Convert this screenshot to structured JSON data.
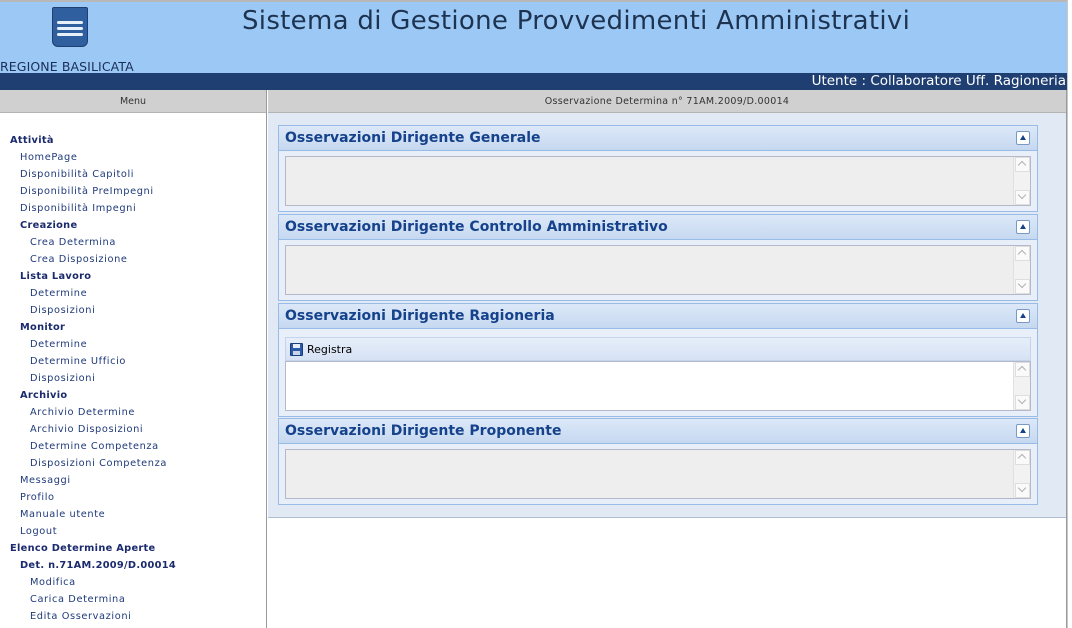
{
  "header": {
    "region_name": "REGIONE BASILICATA",
    "app_title": "Sistema di Gestione Provvedimenti Amministrativi",
    "logo_icon": "region-shield-icon"
  },
  "userbar": {
    "user_text": "Utente : Collaboratore Uff. Ragioneria"
  },
  "sidebar": {
    "menu_header": "Menu",
    "items": [
      {
        "label": "Attività",
        "level": 0,
        "bold": true,
        "link": false
      },
      {
        "label": "HomePage",
        "level": 1,
        "bold": false,
        "link": true
      },
      {
        "label": "Disponibilità Capitoli",
        "level": 1,
        "bold": false,
        "link": true
      },
      {
        "label": "Disponibilità PreImpegni",
        "level": 1,
        "bold": false,
        "link": true
      },
      {
        "label": "Disponibilità Impegni",
        "level": 1,
        "bold": false,
        "link": true
      },
      {
        "label": "Creazione",
        "level": 1,
        "bold": true,
        "link": false
      },
      {
        "label": "Crea Determina",
        "level": 2,
        "bold": false,
        "link": true
      },
      {
        "label": "Crea Disposizione",
        "level": 2,
        "bold": false,
        "link": true
      },
      {
        "label": "Lista Lavoro",
        "level": 1,
        "bold": true,
        "link": false
      },
      {
        "label": "Determine",
        "level": 2,
        "bold": false,
        "link": true
      },
      {
        "label": "Disposizioni",
        "level": 2,
        "bold": false,
        "link": true
      },
      {
        "label": "Monitor",
        "level": 1,
        "bold": true,
        "link": false
      },
      {
        "label": "Determine",
        "level": 2,
        "bold": false,
        "link": true
      },
      {
        "label": "Determine Ufficio",
        "level": 2,
        "bold": false,
        "link": true
      },
      {
        "label": "Disposizioni",
        "level": 2,
        "bold": false,
        "link": true
      },
      {
        "label": "Archivio",
        "level": 1,
        "bold": true,
        "link": false
      },
      {
        "label": "Archivio Determine",
        "level": 2,
        "bold": false,
        "link": true
      },
      {
        "label": "Archivio Disposizioni",
        "level": 2,
        "bold": false,
        "link": true
      },
      {
        "label": "Determine Competenza",
        "level": 2,
        "bold": false,
        "link": true
      },
      {
        "label": "Disposizioni Competenza",
        "level": 2,
        "bold": false,
        "link": true
      },
      {
        "label": "Messaggi",
        "level": 1,
        "bold": false,
        "link": true
      },
      {
        "label": "Profilo",
        "level": 1,
        "bold": false,
        "link": true
      },
      {
        "label": "Manuale utente",
        "level": 1,
        "bold": false,
        "link": true
      },
      {
        "label": "Logout",
        "level": 1,
        "bold": false,
        "link": true
      },
      {
        "label": "Elenco Determine Aperte",
        "level": 0,
        "bold": true,
        "link": false
      },
      {
        "label": "Det. n.71AM.2009/D.00014",
        "level": 1,
        "bold": true,
        "link": false
      },
      {
        "label": "Modifica",
        "level": 2,
        "bold": false,
        "link": true
      },
      {
        "label": "Carica Determina",
        "level": 2,
        "bold": false,
        "link": true
      },
      {
        "label": "Edita Osservazioni",
        "level": 2,
        "bold": false,
        "link": true
      }
    ]
  },
  "content": {
    "header": "Osservazione Determina n° 71AM.2009/D.00014",
    "panels": [
      {
        "title": "Osservazioni Dirigente Generale",
        "text": "",
        "editable": false
      },
      {
        "title": "Osservazioni Dirigente Controllo Amministrativo",
        "text": "",
        "editable": false
      },
      {
        "title": "Osservazioni Dirigente Ragioneria",
        "text": "",
        "editable": true,
        "toolbar_button": "Registra",
        "toolbar_icon": "floppy-disk-icon"
      },
      {
        "title": "Osservazioni Dirigente Proponente",
        "text": "",
        "editable": false
      }
    ]
  },
  "colors": {
    "header_bg": "#9cc8f6",
    "userbar_bg": "#1f3f73",
    "panel_title": "#15428b",
    "menu_link": "#1f3a7a"
  }
}
